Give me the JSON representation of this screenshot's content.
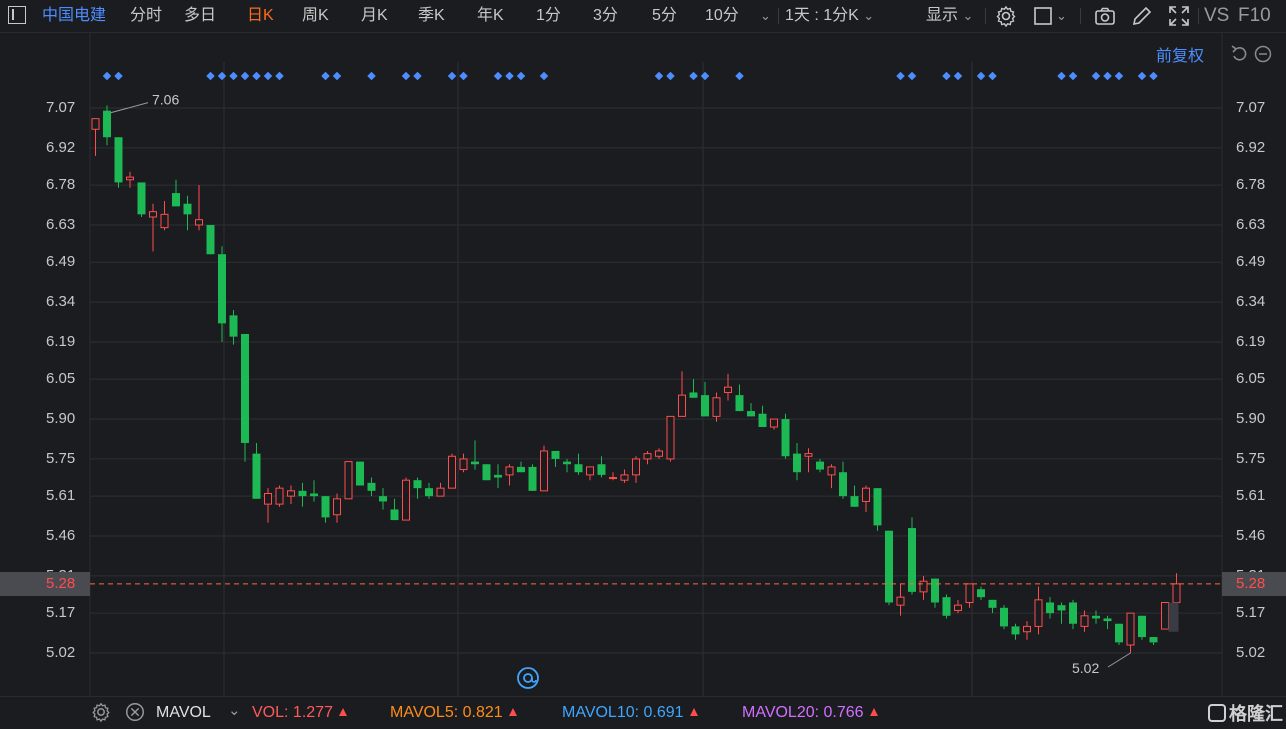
{
  "toolbar": {
    "stock_name": "中国电建",
    "tabs": [
      "分时",
      "多日",
      "日K",
      "周K",
      "月K",
      "季K",
      "年K",
      "1分",
      "3分",
      "5分",
      "10分"
    ],
    "active_tab": "日K",
    "period_select": "1天 : 1分K",
    "display_label": "显示",
    "vs_label": "VS",
    "f10_label": "F10"
  },
  "adjust_label": "前复权",
  "price_axis": {
    "left_ticks": [
      "7.07",
      "6.92",
      "6.78",
      "6.63",
      "6.49",
      "6.34",
      "6.19",
      "6.05",
      "5.90",
      "5.75",
      "5.61",
      "5.46",
      "5.31",
      "5.17",
      "5.02"
    ],
    "right_ticks": [
      "7.07",
      "6.92",
      "6.78",
      "6.63",
      "6.49",
      "6.34",
      "6.19",
      "6.05",
      "5.90",
      "5.75",
      "5.61",
      "5.46",
      "5.31",
      "5.17",
      "5.02"
    ],
    "current_price": "5.28",
    "ylim": [
      4.93,
      7.16
    ]
  },
  "annotations": {
    "high": "7.06",
    "low": "5.02"
  },
  "colors": {
    "up": "#ff4d4d",
    "down": "#1db954",
    "dots": "#4d8dff",
    "grid": "#2e2f33",
    "dashed_line": "#ff6a3d",
    "accent": "#ff6a1a"
  },
  "chart_data": {
    "type": "candlestick",
    "ylim": [
      4.93,
      7.16
    ],
    "candles": [
      {
        "o": 6.99,
        "h": 7.03,
        "l": 6.89,
        "c": 7.03
      },
      {
        "o": 7.06,
        "h": 7.08,
        "l": 6.93,
        "c": 6.96
      },
      {
        "o": 6.96,
        "h": 6.96,
        "l": 6.77,
        "c": 6.79
      },
      {
        "o": 6.8,
        "h": 6.83,
        "l": 6.77,
        "c": 6.81
      },
      {
        "o": 6.79,
        "h": 6.79,
        "l": 6.66,
        "c": 6.67
      },
      {
        "o": 6.66,
        "h": 6.71,
        "l": 6.53,
        "c": 6.68
      },
      {
        "o": 6.62,
        "h": 6.72,
        "l": 6.61,
        "c": 6.67
      },
      {
        "o": 6.75,
        "h": 6.8,
        "l": 6.7,
        "c": 6.7
      },
      {
        "o": 6.71,
        "h": 6.74,
        "l": 6.61,
        "c": 6.67
      },
      {
        "o": 6.63,
        "h": 6.78,
        "l": 6.61,
        "c": 6.65
      },
      {
        "o": 6.63,
        "h": 6.63,
        "l": 6.52,
        "c": 6.52
      },
      {
        "o": 6.52,
        "h": 6.55,
        "l": 6.19,
        "c": 6.26
      },
      {
        "o": 6.29,
        "h": 6.31,
        "l": 6.18,
        "c": 6.21
      },
      {
        "o": 6.22,
        "h": 6.22,
        "l": 5.74,
        "c": 5.81
      },
      {
        "o": 5.77,
        "h": 5.81,
        "l": 5.61,
        "c": 5.6
      },
      {
        "o": 5.58,
        "h": 5.64,
        "l": 5.51,
        "c": 5.62
      },
      {
        "o": 5.58,
        "h": 5.65,
        "l": 5.57,
        "c": 5.64
      },
      {
        "o": 5.61,
        "h": 5.65,
        "l": 5.58,
        "c": 5.63
      },
      {
        "o": 5.63,
        "h": 5.66,
        "l": 5.57,
        "c": 5.61
      },
      {
        "o": 5.62,
        "h": 5.67,
        "l": 5.59,
        "c": 5.61
      },
      {
        "o": 5.61,
        "h": 5.61,
        "l": 5.51,
        "c": 5.53
      },
      {
        "o": 5.54,
        "h": 5.62,
        "l": 5.51,
        "c": 5.6
      },
      {
        "o": 5.6,
        "h": 5.74,
        "l": 5.6,
        "c": 5.74
      },
      {
        "o": 5.74,
        "h": 5.74,
        "l": 5.65,
        "c": 5.65
      },
      {
        "o": 5.66,
        "h": 5.68,
        "l": 5.61,
        "c": 5.63
      },
      {
        "o": 5.61,
        "h": 5.64,
        "l": 5.56,
        "c": 5.59
      },
      {
        "o": 5.56,
        "h": 5.6,
        "l": 5.52,
        "c": 5.52
      },
      {
        "o": 5.52,
        "h": 5.68,
        "l": 5.52,
        "c": 5.67
      },
      {
        "o": 5.67,
        "h": 5.68,
        "l": 5.6,
        "c": 5.64
      },
      {
        "o": 5.64,
        "h": 5.66,
        "l": 5.6,
        "c": 5.61
      },
      {
        "o": 5.61,
        "h": 5.66,
        "l": 5.61,
        "c": 5.64
      },
      {
        "o": 5.64,
        "h": 5.77,
        "l": 5.64,
        "c": 5.76
      },
      {
        "o": 5.71,
        "h": 5.77,
        "l": 5.7,
        "c": 5.75
      },
      {
        "o": 5.74,
        "h": 5.82,
        "l": 5.71,
        "c": 5.73
      },
      {
        "o": 5.73,
        "h": 5.73,
        "l": 5.67,
        "c": 5.67
      },
      {
        "o": 5.69,
        "h": 5.73,
        "l": 5.64,
        "c": 5.68
      },
      {
        "o": 5.69,
        "h": 5.73,
        "l": 5.65,
        "c": 5.72
      },
      {
        "o": 5.72,
        "h": 5.74,
        "l": 5.7,
        "c": 5.7
      },
      {
        "o": 5.72,
        "h": 5.73,
        "l": 5.63,
        "c": 5.63
      },
      {
        "o": 5.63,
        "h": 5.8,
        "l": 5.63,
        "c": 5.78
      },
      {
        "o": 5.78,
        "h": 5.78,
        "l": 5.72,
        "c": 5.75
      },
      {
        "o": 5.74,
        "h": 5.75,
        "l": 5.7,
        "c": 5.73
      },
      {
        "o": 5.73,
        "h": 5.77,
        "l": 5.69,
        "c": 5.7
      },
      {
        "o": 5.69,
        "h": 5.72,
        "l": 5.67,
        "c": 5.72
      },
      {
        "o": 5.73,
        "h": 5.76,
        "l": 5.68,
        "c": 5.69
      },
      {
        "o": 5.68,
        "h": 5.7,
        "l": 5.67,
        "c": 5.68
      },
      {
        "o": 5.67,
        "h": 5.71,
        "l": 5.66,
        "c": 5.69
      },
      {
        "o": 5.69,
        "h": 5.76,
        "l": 5.66,
        "c": 5.75
      },
      {
        "o": 5.75,
        "h": 5.78,
        "l": 5.73,
        "c": 5.77
      },
      {
        "o": 5.76,
        "h": 5.79,
        "l": 5.75,
        "c": 5.78
      },
      {
        "o": 5.75,
        "h": 5.91,
        "l": 5.74,
        "c": 5.91
      },
      {
        "o": 5.91,
        "h": 6.08,
        "l": 5.91,
        "c": 5.99
      },
      {
        "o": 6.0,
        "h": 6.05,
        "l": 5.98,
        "c": 5.98
      },
      {
        "o": 5.99,
        "h": 6.04,
        "l": 5.91,
        "c": 5.91
      },
      {
        "o": 5.91,
        "h": 6.0,
        "l": 5.89,
        "c": 5.98
      },
      {
        "o": 6.0,
        "h": 6.07,
        "l": 5.97,
        "c": 6.02
      },
      {
        "o": 5.99,
        "h": 6.03,
        "l": 5.93,
        "c": 5.93
      },
      {
        "o": 5.93,
        "h": 5.96,
        "l": 5.91,
        "c": 5.91
      },
      {
        "o": 5.92,
        "h": 5.95,
        "l": 5.87,
        "c": 5.87
      },
      {
        "o": 5.87,
        "h": 5.9,
        "l": 5.86,
        "c": 5.9
      },
      {
        "o": 5.9,
        "h": 5.92,
        "l": 5.75,
        "c": 5.76
      },
      {
        "o": 5.77,
        "h": 5.81,
        "l": 5.67,
        "c": 5.7
      },
      {
        "o": 5.76,
        "h": 5.79,
        "l": 5.7,
        "c": 5.77
      },
      {
        "o": 5.74,
        "h": 5.75,
        "l": 5.7,
        "c": 5.71
      },
      {
        "o": 5.69,
        "h": 5.73,
        "l": 5.64,
        "c": 5.72
      },
      {
        "o": 5.7,
        "h": 5.74,
        "l": 5.6,
        "c": 5.61
      },
      {
        "o": 5.61,
        "h": 5.65,
        "l": 5.57,
        "c": 5.57
      },
      {
        "o": 5.59,
        "h": 5.65,
        "l": 5.55,
        "c": 5.64
      },
      {
        "o": 5.64,
        "h": 5.64,
        "l": 5.48,
        "c": 5.5
      },
      {
        "o": 5.48,
        "h": 5.48,
        "l": 5.2,
        "c": 5.21
      },
      {
        "o": 5.2,
        "h": 5.28,
        "l": 5.16,
        "c": 5.23
      },
      {
        "o": 5.49,
        "h": 5.53,
        "l": 5.24,
        "c": 5.25
      },
      {
        "o": 5.25,
        "h": 5.31,
        "l": 5.22,
        "c": 5.29
      },
      {
        "o": 5.3,
        "h": 5.3,
        "l": 5.19,
        "c": 5.21
      },
      {
        "o": 5.23,
        "h": 5.24,
        "l": 5.15,
        "c": 5.16
      },
      {
        "o": 5.18,
        "h": 5.22,
        "l": 5.17,
        "c": 5.2
      },
      {
        "o": 5.21,
        "h": 5.28,
        "l": 5.19,
        "c": 5.28
      },
      {
        "o": 5.26,
        "h": 5.27,
        "l": 5.22,
        "c": 5.23
      },
      {
        "o": 5.22,
        "h": 5.22,
        "l": 5.17,
        "c": 5.19
      },
      {
        "o": 5.19,
        "h": 5.2,
        "l": 5.11,
        "c": 5.12
      },
      {
        "o": 5.12,
        "h": 5.13,
        "l": 5.07,
        "c": 5.09
      },
      {
        "o": 5.1,
        "h": 5.14,
        "l": 5.07,
        "c": 5.12
      },
      {
        "o": 5.12,
        "h": 5.27,
        "l": 5.09,
        "c": 5.22
      },
      {
        "o": 5.21,
        "h": 5.23,
        "l": 5.15,
        "c": 5.17
      },
      {
        "o": 5.2,
        "h": 5.21,
        "l": 5.13,
        "c": 5.18
      },
      {
        "o": 5.21,
        "h": 5.22,
        "l": 5.11,
        "c": 5.13
      },
      {
        "o": 5.12,
        "h": 5.18,
        "l": 5.1,
        "c": 5.16
      },
      {
        "o": 5.16,
        "h": 5.18,
        "l": 5.13,
        "c": 5.15
      },
      {
        "o": 5.15,
        "h": 5.16,
        "l": 5.11,
        "c": 5.14
      },
      {
        "o": 5.13,
        "h": 5.13,
        "l": 5.05,
        "c": 5.06
      },
      {
        "o": 5.05,
        "h": 5.16,
        "l": 5.02,
        "c": 5.17
      },
      {
        "o": 5.16,
        "h": 5.16,
        "l": 5.07,
        "c": 5.08
      },
      {
        "o": 5.08,
        "h": 5.08,
        "l": 5.05,
        "c": 5.06
      },
      {
        "o": 5.11,
        "h": 5.21,
        "l": 5.11,
        "c": 5.21
      },
      {
        "o": 5.21,
        "h": 5.32,
        "l": 5.19,
        "c": 5.28
      }
    ],
    "dot_indices": [
      1,
      2,
      10,
      11,
      12,
      13,
      14,
      15,
      16,
      20,
      21,
      24,
      27,
      28,
      31,
      32,
      35,
      36,
      37,
      39,
      49,
      50,
      52,
      53,
      56,
      70,
      71,
      74,
      75,
      77,
      78,
      84,
      85,
      87,
      88,
      89,
      91,
      92
    ]
  },
  "indicator_bar": {
    "name": "MAVOL",
    "vol_label": "VOL:",
    "vol_value": "1.277",
    "mavol5_label": "MAVOL5:",
    "mavol5_value": "0.821",
    "mavol10_label": "MAVOL10:",
    "mavol10_value": "0.691",
    "mavol20_label": "MAVOL20:",
    "mavol20_value": "0.766",
    "colors": {
      "vol": "#ff5a5a",
      "mavol5": "#ff8c1a",
      "mavol10": "#3fa6ff",
      "mavol20": "#d070ff"
    }
  },
  "brand": "格隆汇"
}
